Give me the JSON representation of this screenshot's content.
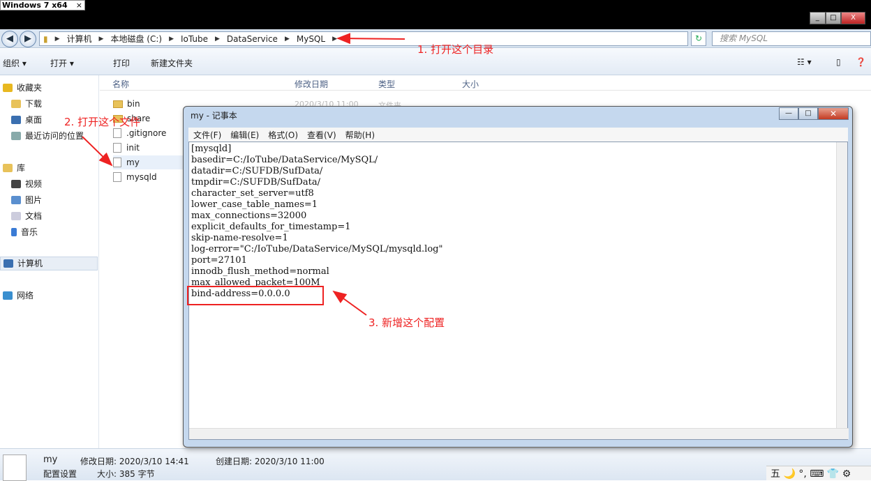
{
  "vm": {
    "tab": "Windows 7 x64",
    "close": "×"
  },
  "window_buttons": {
    "min": "_",
    "max": "□",
    "close": "X"
  },
  "nav": {
    "back": "◀",
    "forward": "▶"
  },
  "breadcrumb": [
    "计算机",
    "本地磁盘 (C:)",
    "IoTube",
    "DataService",
    "MySQL"
  ],
  "search_placeholder": "搜索 MySQL",
  "toolbar": {
    "organize": "组织 ▾",
    "open": "打开 ▾",
    "print": "打印",
    "new_folder": "新建文件夹"
  },
  "sidebar": {
    "favorites": "收藏夹",
    "downloads": "下载",
    "desktop": "桌面",
    "recent": "最近访问的位置",
    "library": "库",
    "videos": "视频",
    "pictures": "图片",
    "documents": "文档",
    "music": "音乐",
    "computer": "计算机",
    "network": "网络"
  },
  "columns": {
    "name": "名称",
    "date": "修改日期",
    "type": "类型",
    "size": "大小"
  },
  "files": [
    "bin",
    "share",
    ".gitignore",
    "init",
    "my",
    "mysqld"
  ],
  "file_meta": {
    "date": "2020/3/10 11:00",
    "type": "文件夹"
  },
  "notepad": {
    "title": "my - 记事本",
    "menu": [
      "文件(F)",
      "编辑(E)",
      "格式(O)",
      "查看(V)",
      "帮助(H)"
    ],
    "content": "[mysqld]\nbasedir=C:/IoTube/DataService/MySQL/\ndatadir=C:/SUFDB/SufData/\ntmpdir=C:/SUFDB/SufData/\ncharacter_set_server=utf8\nlower_case_table_names=1\nmax_connections=32000\nexplicit_defaults_for_timestamp=1\nskip-name-resolve=1\nlog-error=\"C:/IoTube/DataService/MySQL/mysqld.log\"\nport=27101\ninnodb_flush_method=normal\nmax_allowed_packet=100M\nbind-address=0.0.0.0"
  },
  "annotations": {
    "a1": "1. 打开这个目录",
    "a2": "2. 打开这个文件",
    "a3": "3. 新增这个配置"
  },
  "status": {
    "name": "my",
    "modified": "修改日期: 2020/3/10 14:41",
    "created": "创建日期: 2020/3/10 11:00",
    "type": "配置设置",
    "size": "大小: 385 字节"
  },
  "tray": "五 🌙 °, ⌨ 👕 ⚙"
}
